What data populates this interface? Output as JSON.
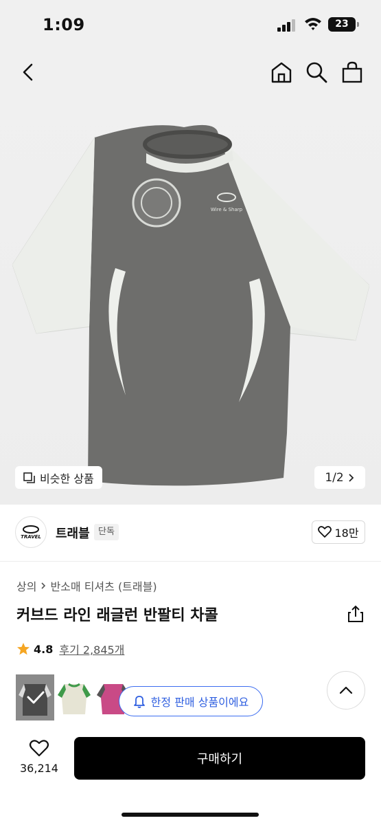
{
  "status_bar": {
    "time": "1:09",
    "battery": "23"
  },
  "nav": {
    "back_icon": "chevron-left-icon",
    "home_icon": "home-icon",
    "search_icon": "search-icon",
    "bag_icon": "shopping-bag-icon"
  },
  "hero": {
    "similar_label": "비슷한 상품",
    "pager": "1/2",
    "print_brand": "Wire & Sharp"
  },
  "brand": {
    "logo_text": "TRAVEL",
    "name": "트래블",
    "tag": "단독",
    "likes": "18만"
  },
  "product": {
    "breadcrumb": [
      "상의",
      "반소매 티셔츠 (트래블)"
    ],
    "title": "커브드 라인 래글런 반팔티 차콜",
    "rating": "4.8",
    "reviews": "후기 2,845개"
  },
  "options": {
    "limited_label": "한정 판매 상품이에요"
  },
  "bottom_bar": {
    "wish_count": "36,214",
    "buy_label": "구매하기"
  },
  "colors": {
    "accent": "#2f5fe0",
    "star": "#f5a623",
    "buy_bg": "#000000"
  }
}
